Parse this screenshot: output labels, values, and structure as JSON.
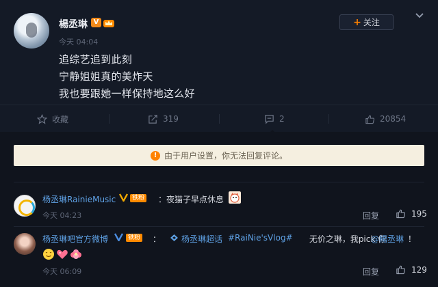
{
  "post": {
    "author": "楊丞琳",
    "vip_badge": "V",
    "time": "今天 04:04",
    "lines": [
      "追综艺追到此刻",
      "宁静姐姐真的美炸天",
      "我也要跟她一样保持地这么好"
    ],
    "follow_label": "关注"
  },
  "actions": {
    "favorite": "收藏",
    "repost_count": "319",
    "comment_count": "2",
    "like_count": "20854"
  },
  "notice": {
    "text": "由于用户设置，你无法回复评论。",
    "icon": "!"
  },
  "comments": [
    {
      "name": "杨丞琳RainieMusic",
      "badge": "铁粉",
      "text": "：夜猫子早点休息",
      "time": "今天 04:23",
      "reply": "回复",
      "likes": "195"
    },
    {
      "name": "杨丞琳吧官方微博",
      "badge": "铁粉",
      "prefix": "：",
      "topic": "杨丞琳超话",
      "hashtag": "#RaiNie'sVlog#",
      "text_mid": " 无价之琳，我pick 你",
      "mention": "@楊丞琳",
      "text_end": " ！",
      "time": "今天 06:09",
      "reply": "回复",
      "likes": "129"
    }
  ],
  "colors": {
    "accent": "#ff8200",
    "link": "#5fa2e6",
    "background": "#10141d"
  }
}
